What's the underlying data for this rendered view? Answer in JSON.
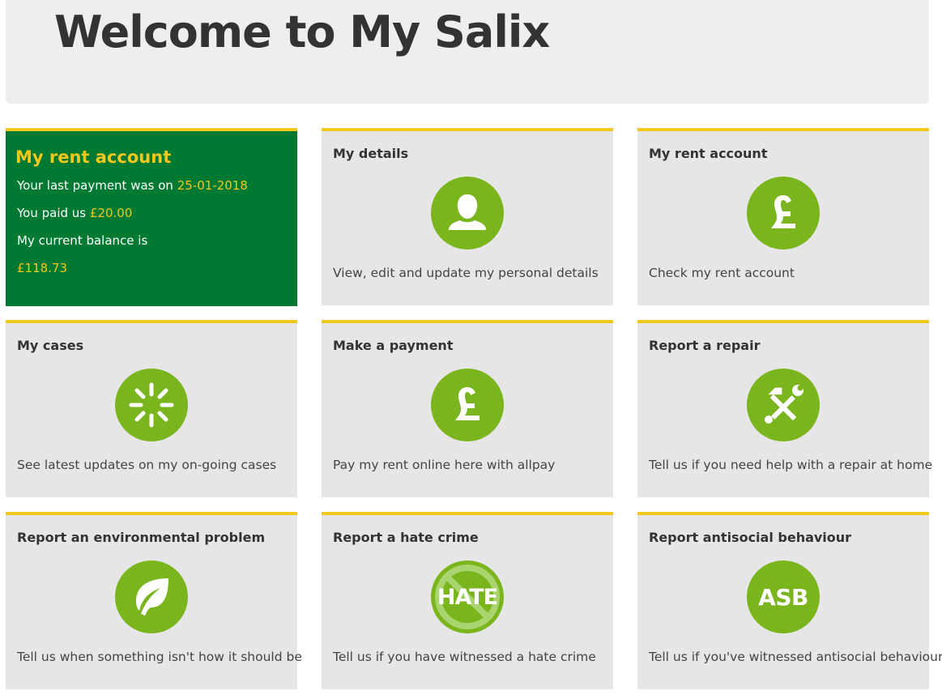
{
  "page": {
    "title": "Welcome to My Salix"
  },
  "rent_summary": {
    "title": "My rent account",
    "last_payment_prefix": "Your last payment was on",
    "last_payment_date": "25-01-2018",
    "paid_prefix": "You paid us",
    "paid_amount": "£20.00",
    "balance_label": "My current balance is",
    "balance_amount": "£118.73"
  },
  "tiles": [
    {
      "title": "My details",
      "icon": "person-icon",
      "description": "View, edit and update my personal details"
    },
    {
      "title": "My rent account",
      "icon": "pound-icon",
      "description": "Check my rent account"
    },
    {
      "title": "My cases",
      "icon": "spinner-icon",
      "description": "See latest updates on my on-going cases"
    },
    {
      "title": "Make a payment",
      "icon": "pound-icon",
      "description": "Pay my rent online here with allpay"
    },
    {
      "title": "Report a repair",
      "icon": "tools-icon",
      "description": "Tell us if you need help with a repair at home"
    },
    {
      "title": "Report an environmental problem",
      "icon": "leaf-icon",
      "description": "Tell us when something isn't how it should be"
    },
    {
      "title": "Report a hate crime",
      "icon": "hate-icon",
      "description": "Tell us if you have witnessed a hate crime",
      "icon_text": "HATE"
    },
    {
      "title": "Report antisocial behaviour",
      "icon": "asb-icon",
      "description": "Tell us if you've witnessed antisocial behaviour",
      "icon_text": "ASB"
    }
  ],
  "colors": {
    "accent_yellow": "#f2c71e",
    "dark_green": "#007a33",
    "icon_green": "#7ab51d",
    "tile_grey": "#e6e6e6",
    "header_grey": "#eeeeee"
  }
}
